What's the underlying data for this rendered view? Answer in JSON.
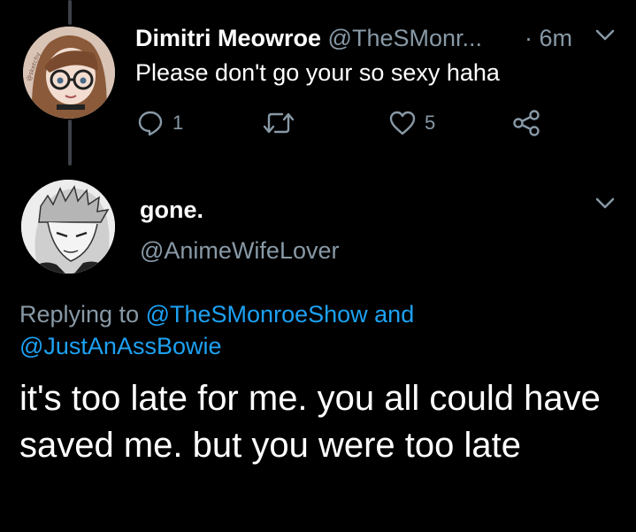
{
  "tweet1": {
    "name": "Dimitri Meowroe",
    "handle": "@TheSMonr...",
    "time": "· 6m",
    "text": "Please don't go your so sexy haha",
    "reply_count": "1",
    "like_count": "5"
  },
  "tweet2": {
    "name": "gone.",
    "handle": "@AnimeWifeLover",
    "replying_to_prefix": "Replying to",
    "replying_to_user1": "@TheSMonroeShow",
    "replying_to_and": "and",
    "replying_to_user2": "@JustAnAssBowie",
    "text": "it's too late for me. you all could have saved me. but you were too late"
  },
  "colors": {
    "background": "#000000",
    "muted": "#8899a6",
    "link": "#1da1f2",
    "thread_line": "#3d4148"
  },
  "icons": [
    "reply-icon",
    "retweet-icon",
    "like-icon",
    "share-icon",
    "chevron-down-icon"
  ]
}
